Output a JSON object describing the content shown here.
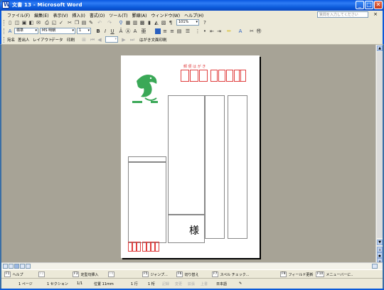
{
  "window": {
    "title": "文書 13 - Microsoft Word",
    "controls": {
      "minimize": "_",
      "maximize": "□",
      "close": "✕"
    }
  },
  "menubar": {
    "items": [
      "ファイル(F)",
      "編集(E)",
      "表示(V)",
      "挿入(I)",
      "書式(O)",
      "ツール(T)",
      "罫線(A)",
      "ウィンドウ(W)",
      "ヘルプ(H)"
    ],
    "help_placeholder": "質問を入力してください",
    "doc_close": "×"
  },
  "toolbar_format": {
    "style": "標準",
    "font": "MS 明朝",
    "size": "1",
    "zoom": "101%"
  },
  "toolbar_hagaki": {
    "items": [
      "宛名",
      "差出人",
      "レイアウト",
      "データ",
      "印刷",
      "はがき文面印刷"
    ]
  },
  "postcard": {
    "zip_label": "郵 便 は が き",
    "honorific": "様"
  },
  "fkeys": [
    {
      "num": "F1",
      "label": "ヘルプ",
      "dim": false
    },
    {
      "num": "F2",
      "label": "",
      "dim": true
    },
    {
      "num": "F3",
      "label": "定型句挿入",
      "dim": false
    },
    {
      "num": "F4",
      "label": "",
      "dim": true
    },
    {
      "num": "F5",
      "label": "ジャンプ...",
      "dim": false
    },
    {
      "num": "F6",
      "label": "切り替え",
      "dim": false
    },
    {
      "num": "F7",
      "label": "スペル チェック...",
      "dim": false
    },
    {
      "num": "F9",
      "label": "フィールド更新",
      "dim": false
    },
    {
      "num": "F10",
      "label": "メニューバーに..",
      "dim": false
    }
  ],
  "statusbar": {
    "page": "1 ページ",
    "section": "1 セクション",
    "pages": "1/1",
    "position": "位置 11mm",
    "line": "1 行",
    "column": "1 桁",
    "rec": "記録",
    "trk": "変更",
    "ext": "拡張",
    "ovr": "上書",
    "lang": "日本語"
  }
}
